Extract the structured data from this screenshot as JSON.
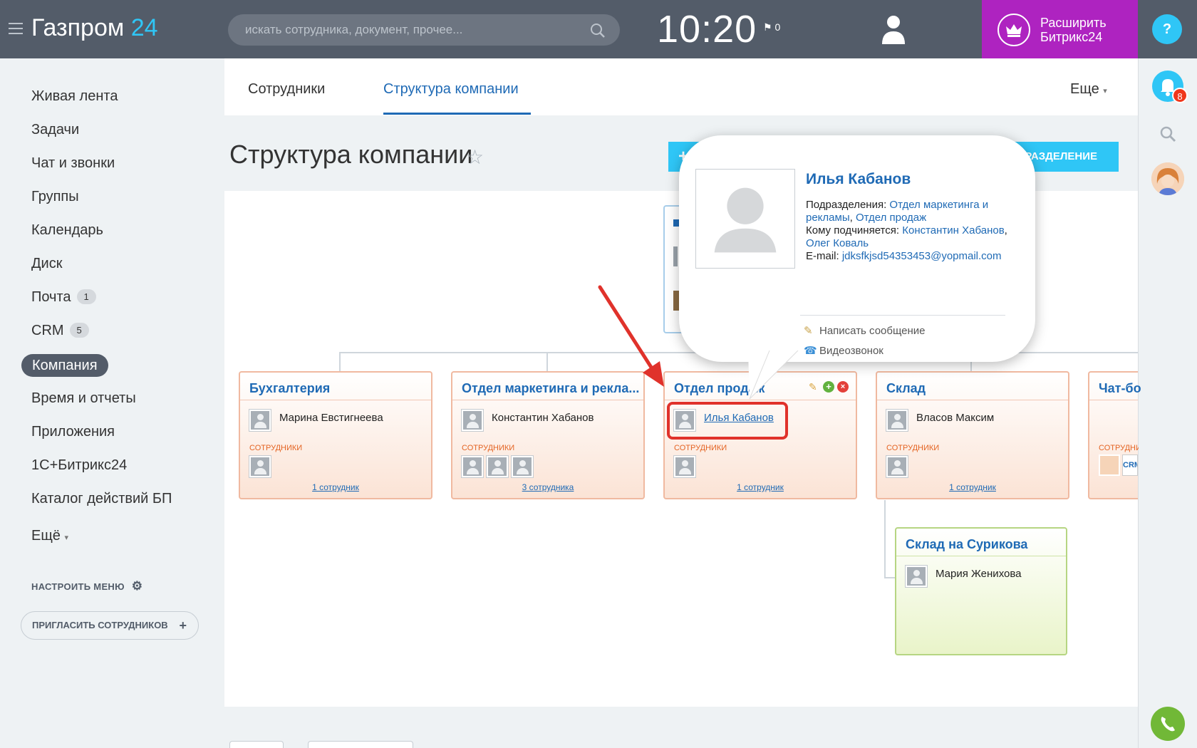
{
  "header": {
    "logo_name": "Газпром",
    "logo_num": "24",
    "search_placeholder": "искать сотрудника, документ, прочее...",
    "time": "10:20",
    "flag_count": "0",
    "upgrade_label": "Расширить Битрикс24"
  },
  "rail": {
    "help": "?",
    "notifications": "8"
  },
  "menu": {
    "items": [
      {
        "label": "Живая лента"
      },
      {
        "label": "Задачи"
      },
      {
        "label": "Чат и звонки"
      },
      {
        "label": "Группы"
      },
      {
        "label": "Календарь"
      },
      {
        "label": "Диск"
      },
      {
        "label": "Почта",
        "count": "1"
      },
      {
        "label": "CRM",
        "count": "5"
      },
      {
        "label": "Компания"
      },
      {
        "label": "Время и отчеты"
      },
      {
        "label": "Приложения"
      },
      {
        "label": "1С+Битрикс24"
      },
      {
        "label": "Каталог действий БП"
      },
      {
        "label": "Ещё"
      }
    ],
    "configure": "НАСТРОИТЬ МЕНЮ",
    "invite": "ПРИГЛАСИТЬ СОТРУДНИКОВ"
  },
  "tabs": {
    "employees": "Сотрудники",
    "structure": "Структура компании",
    "more": "Еще"
  },
  "page": {
    "title": "Структура компании",
    "add_button": "ПОДРАЗДЕЛЕНИЕ"
  },
  "departments": [
    {
      "title": "Бухгалтерия",
      "head": "Марина Евстигнеева",
      "employees_label": "СОТРУДНИКИ",
      "count": "1 сотрудник"
    },
    {
      "title": "Отдел маркетинга и рекла...",
      "head": "Константин Хабанов",
      "employees_label": "СОТРУДНИКИ",
      "count": "3 сотрудника"
    },
    {
      "title": "Отдел продаж",
      "head": "Илья Кабанов",
      "employees_label": "СОТРУДНИКИ",
      "count": "1 сотрудник"
    },
    {
      "title": "Склад",
      "head": "Власов Максим",
      "employees_label": "СОТРУДНИКИ",
      "count": "1 сотрудник"
    },
    {
      "title": "Чат-бо",
      "employees_label": "СОТРУДНИ"
    },
    {
      "title": "Склад на Сурикова",
      "head": "Мария Женихова"
    }
  ],
  "popup": {
    "name": "Илья Кабанов",
    "dept_label": "Подразделения: ",
    "dept1": "Отдел маркетинга и рекламы",
    "dept2": "Отдел продаж",
    "manager_label": "Кому подчиняется: ",
    "manager1": "Константин Хабанов",
    "manager2": "Олег Коваль",
    "email_label": "E-mail: ",
    "email": "jdksfkjsd54353453@yopmail.com",
    "action_message": "Написать сообщение",
    "action_video": "Видеозвонок"
  },
  "colors": {
    "topbar": "#535c69",
    "accent": "#2fc6f6",
    "upgrade": "#ae23c0",
    "link": "#1f6ab5",
    "highlight": "#e0322b"
  }
}
